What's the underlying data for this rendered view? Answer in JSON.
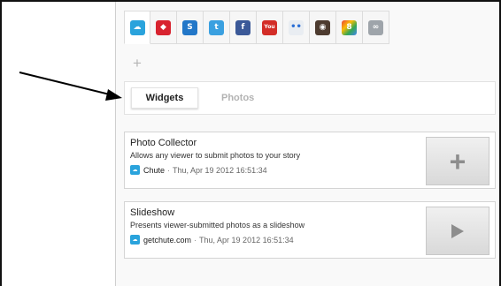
{
  "services": [
    {
      "name": "chute-icon",
      "glyph": "☁",
      "bg": "#2aa3dc",
      "active": true
    },
    {
      "name": "flickr-gem-icon",
      "glyph": "◆",
      "bg": "#d8232f"
    },
    {
      "name": "picasa-icon",
      "glyph": "S",
      "bg": "#2277c8"
    },
    {
      "name": "twitter-icon",
      "glyph": "t",
      "bg": "#3aa0e0"
    },
    {
      "name": "facebook-icon",
      "glyph": "f",
      "bg": "#3b5998"
    },
    {
      "name": "youtube-icon",
      "glyph": "You",
      "bg": "#d32d27"
    },
    {
      "name": "flickr-icon",
      "glyph": "••",
      "bg": "#e9edf2"
    },
    {
      "name": "instagram-icon",
      "glyph": "◉",
      "bg": "#4d3b2f"
    },
    {
      "name": "google-icon",
      "glyph": "8",
      "bg": "#3a9b46"
    },
    {
      "name": "link-icon",
      "glyph": "∞",
      "bg": "#9ea4aa"
    }
  ],
  "add_service": "+",
  "tabs": {
    "widgets": "Widgets",
    "photos": "Photos"
  },
  "widgets": [
    {
      "title": "Photo Collector",
      "description": "Allows any viewer to submit photos to your story",
      "source": "Chute",
      "date": "Thu, Apr 19 2012 16:51:34",
      "separator": "·",
      "button": "add"
    },
    {
      "title": "Slideshow",
      "description": "Presents viewer-submitted photos as a slideshow",
      "source": "getchute.com",
      "date": "Thu, Apr 19 2012 16:51:34",
      "separator": "·",
      "button": "play"
    }
  ]
}
